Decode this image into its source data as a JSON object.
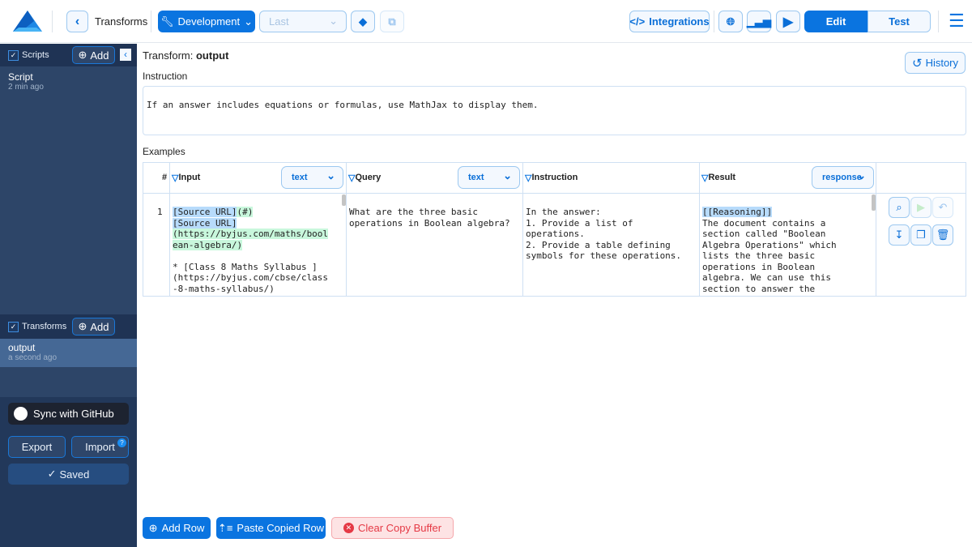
{
  "header": {
    "breadcrumb": "Transforms",
    "env_label": "Development",
    "version_placeholder": "Last",
    "integrations_label": "Integrations",
    "edit_label": "Edit",
    "test_label": "Test"
  },
  "sidebar": {
    "scripts_label": "Scripts",
    "add_label": "Add",
    "scripts": [
      {
        "name": "Script",
        "time": "2 min ago"
      }
    ],
    "transforms_label": "Transforms",
    "transforms": [
      {
        "name": "output",
        "time": "a second ago"
      }
    ],
    "github_label": "Sync with GitHub",
    "export_label": "Export",
    "import_label": "Import",
    "saved_label": "Saved"
  },
  "main": {
    "title_prefix": "Transform:",
    "title_name": "output",
    "history_label": "History",
    "instruction_label": "Instruction",
    "instruction_value": "If an answer includes equations or formulas, use MathJax to display them.",
    "examples_label": "Examples",
    "table": {
      "columns": [
        {
          "label": "#"
        },
        {
          "label": "Input",
          "type": "text"
        },
        {
          "label": "Query",
          "type": "text"
        },
        {
          "label": "Instruction"
        },
        {
          "label": "Result",
          "type": "response"
        }
      ],
      "rows": [
        {
          "num": "1",
          "input_hl1": "[Source URL]",
          "input_a": "(#)",
          "input_hl2": "[Source URL]",
          "input_b": "(https://byjus.com/maths/bool\nean-algebra/)",
          "input_rest": "\n* [Class 8 Maths Syllabus ]\n(https://byjus.com/cbse/class\n-8-maths-syllabus/)",
          "query": "What are the three basic\noperations in Boolean algebra?",
          "instruction": "In the answer:\n1. Provide a list of\noperations.\n2. Provide a table defining\nsymbols for these operations.",
          "result_hl": "[[Reasoning]]",
          "result": "The document contains a\nsection called \"Boolean\nAlgebra Operations\" which\nlists the three basic\noperations in Boolean\nalgebra. We can use this\nsection to answer the"
        }
      ]
    },
    "add_row_label": "Add Row",
    "paste_label": "Paste Copied Row",
    "clear_label": "Clear Copy Buffer"
  },
  "colors": {
    "accent": "#0a74e0",
    "sidebar": "#22385a",
    "danger": "#e53945"
  }
}
